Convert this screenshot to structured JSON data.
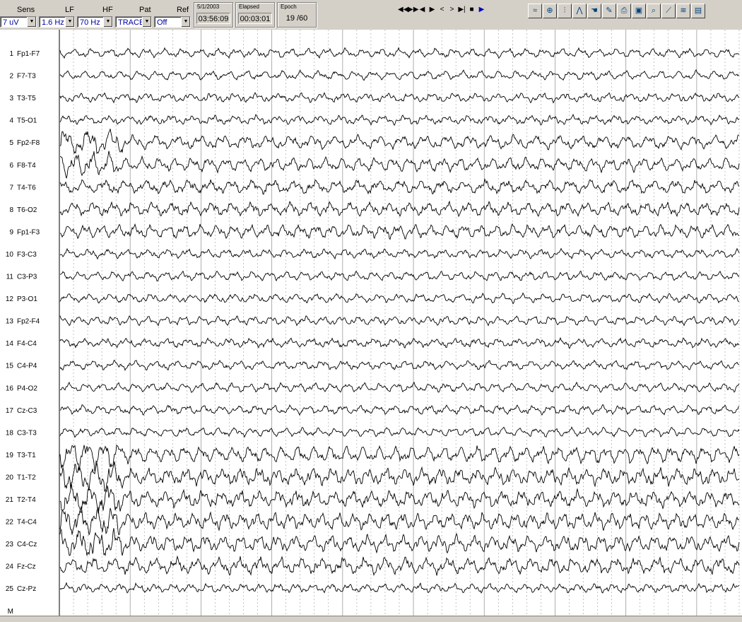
{
  "toolbar": {
    "sens": {
      "label": "Sens",
      "value": "7 uV"
    },
    "lf": {
      "label": "LF",
      "value": "1.6 Hz"
    },
    "hf": {
      "label": "HF",
      "value": "70 Hz"
    },
    "pat": {
      "label": "Pat",
      "value": "TRACE"
    },
    "ref": {
      "label": "Ref",
      "value": "Off"
    },
    "date_group": {
      "title": "5/1/2003",
      "value": "03:56:09"
    },
    "elapsed_group": {
      "title": "Elapsed",
      "value": "00:03:01"
    },
    "epoch_group": {
      "title": "Epoch",
      "value": "19 /60"
    },
    "nav_buttons": [
      {
        "name": "rewind-start-icon",
        "glyph": "◀◀"
      },
      {
        "name": "fast-forward-icon",
        "glyph": "▶▶"
      },
      {
        "name": "step-back-icon",
        "glyph": "◀"
      },
      {
        "name": "step-forward-icon",
        "glyph": "▶"
      },
      {
        "name": "page-back-icon",
        "glyph": "<"
      },
      {
        "name": "page-forward-icon",
        "glyph": ">"
      },
      {
        "name": "goto-end-icon",
        "glyph": "▶|"
      },
      {
        "name": "stop-icon",
        "glyph": "■"
      },
      {
        "name": "play-icon",
        "glyph": "▶"
      }
    ],
    "tools": [
      {
        "name": "waveform-icon",
        "glyph": "≈"
      },
      {
        "name": "montage-icon",
        "glyph": "⊕"
      },
      {
        "name": "spike-icon",
        "glyph": "⫶"
      },
      {
        "name": "event-icon",
        "glyph": "⋀"
      },
      {
        "name": "hand-icon",
        "glyph": "☚"
      },
      {
        "name": "note-icon",
        "glyph": "✎"
      },
      {
        "name": "print-icon",
        "glyph": "⎙"
      },
      {
        "name": "camera-icon",
        "glyph": "▣"
      },
      {
        "name": "zoom-icon",
        "glyph": "⌕"
      },
      {
        "name": "measure-icon",
        "glyph": "⟋"
      },
      {
        "name": "filter-icon",
        "glyph": "≋"
      },
      {
        "name": "video-icon",
        "glyph": "▤"
      }
    ]
  },
  "channels": [
    {
      "num": "1",
      "name": "Fp1-F7"
    },
    {
      "num": "2",
      "name": "F7-T3"
    },
    {
      "num": "3",
      "name": "T3-T5"
    },
    {
      "num": "4",
      "name": "T5-O1"
    },
    {
      "num": "5",
      "name": "Fp2-F8"
    },
    {
      "num": "6",
      "name": "F8-T4"
    },
    {
      "num": "7",
      "name": "T4-T6"
    },
    {
      "num": "8",
      "name": "T6-O2"
    },
    {
      "num": "9",
      "name": "Fp1-F3"
    },
    {
      "num": "10",
      "name": "F3-C3"
    },
    {
      "num": "11",
      "name": "C3-P3"
    },
    {
      "num": "12",
      "name": "P3-O1"
    },
    {
      "num": "13",
      "name": "Fp2-F4"
    },
    {
      "num": "14",
      "name": "F4-C4"
    },
    {
      "num": "15",
      "name": "C4-P4"
    },
    {
      "num": "16",
      "name": "P4-O2"
    },
    {
      "num": "17",
      "name": "Cz-C3"
    },
    {
      "num": "18",
      "name": "C3-T3"
    },
    {
      "num": "19",
      "name": "T3-T1"
    },
    {
      "num": "20",
      "name": "T1-T2"
    },
    {
      "num": "21",
      "name": "T2-T4"
    },
    {
      "num": "22",
      "name": "T4-C4"
    },
    {
      "num": "23",
      "name": "C4-Cz"
    },
    {
      "num": "24",
      "name": "Fz-Cz"
    },
    {
      "num": "25",
      "name": "Cz-Pz"
    },
    {
      "num": "M",
      "name": ""
    }
  ],
  "colors": {
    "trace": "#000000",
    "grid": "#9a9a9a",
    "select_text": "#0000a0",
    "play": "#0000c0"
  }
}
